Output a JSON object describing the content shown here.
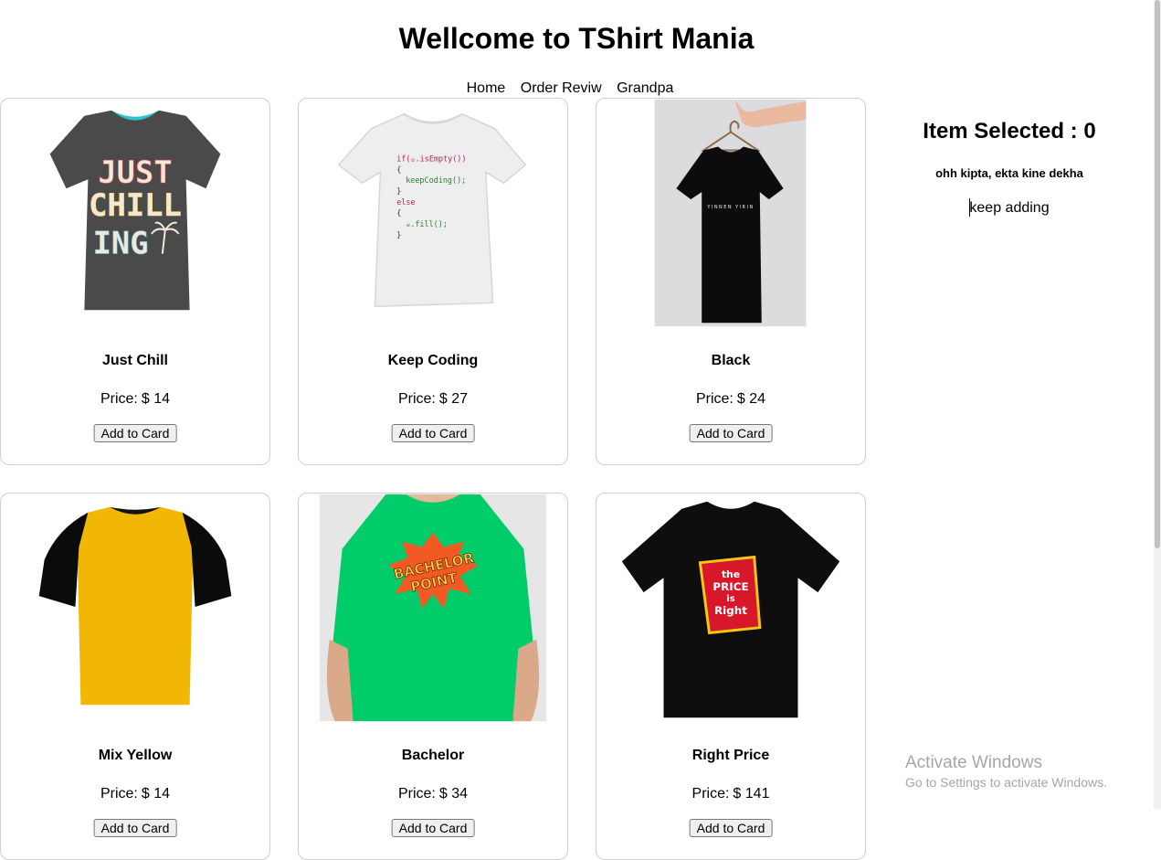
{
  "header": {
    "title": "Wellcome to TShirt Mania"
  },
  "nav": {
    "items": [
      "Home",
      "Order Reviw",
      "Grandpa"
    ]
  },
  "products": [
    {
      "name": "Just Chill",
      "price_label": "Price:",
      "price": "$ 14",
      "button": "Add to Card",
      "image_icon": "tshirt-just-chill-image"
    },
    {
      "name": "Keep Coding",
      "price_label": "Price:",
      "price": "$ 27",
      "button": "Add to Card",
      "image_icon": "tshirt-keep-coding-image"
    },
    {
      "name": "Black",
      "price_label": "Price:",
      "price": "$ 24",
      "button": "Add to Card",
      "image_icon": "tshirt-black-image"
    },
    {
      "name": "Mix Yellow",
      "price_label": "Price:",
      "price": "$ 14",
      "button": "Add to Card",
      "image_icon": "tshirt-mix-yellow-image"
    },
    {
      "name": "Bachelor",
      "price_label": "Price:",
      "price": "$ 34",
      "button": "Add to Card",
      "image_icon": "tshirt-bachelor-image"
    },
    {
      "name": "Right Price",
      "price_label": "Price:",
      "price": "$ 141",
      "button": "Add to Card",
      "image_icon": "tshirt-right-price-image"
    }
  ],
  "cart": {
    "title": "Item Selected : 0",
    "subtitle": "ohh kipta, ekta kine dekha",
    "hint": "keep adding"
  },
  "watermark": {
    "line1": "Activate Windows",
    "line2": "Go to Settings to activate Windows."
  },
  "image_text": {
    "just_chill": [
      "JUST",
      "CHILL",
      "ING"
    ],
    "keep_coding": [
      "if(☕.isEmpty())",
      "{",
      "keepCoding();",
      "}",
      "else",
      "{",
      "☕.fill();",
      "}"
    ],
    "black": "YINNEN YIRIN",
    "bachelor": [
      "BACHELOR",
      "POINT"
    ],
    "right_price": [
      "the",
      "PRICE",
      "is",
      "Right"
    ]
  },
  "colors": {
    "accent_green": "#00cc6a",
    "yellow": "#f2b705",
    "charcoal": "#4a4a4a"
  }
}
